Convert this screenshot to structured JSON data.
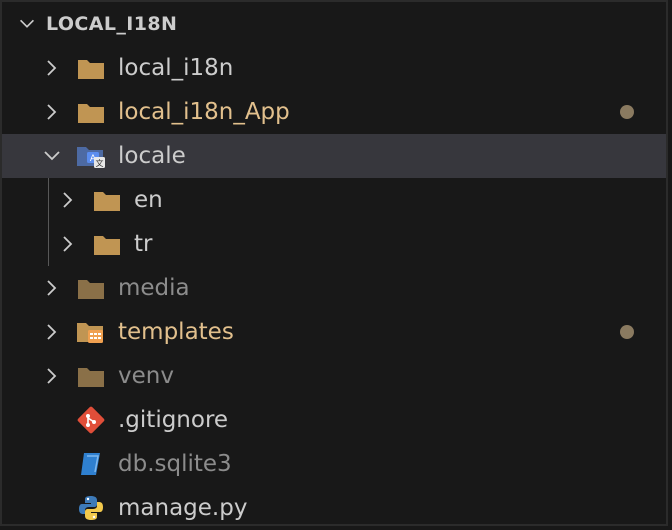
{
  "explorer": {
    "root_title": "LOCAL_I18N",
    "items": [
      {
        "label": "local_i18n"
      },
      {
        "label": "local_i18n_App"
      },
      {
        "label": "locale"
      },
      {
        "label": "en"
      },
      {
        "label": "tr"
      },
      {
        "label": "media"
      },
      {
        "label": "templates"
      },
      {
        "label": "venv"
      },
      {
        "label": ".gitignore"
      },
      {
        "label": "db.sqlite3"
      },
      {
        "label": "manage.py"
      }
    ]
  },
  "colors": {
    "background": "#181818",
    "selected_row": "#37373d",
    "text_default": "#cccccc",
    "text_modified": "#e2c08d",
    "text_ignored": "#8c8c8c",
    "folder": "#c09553",
    "modified_dot": "#8a7a60"
  },
  "icons": {
    "folder": "folder-icon",
    "locale": "translate-folder-icon",
    "templates": "templates-folder-icon",
    "gitignore": "git-icon",
    "sqlite": "database-icon",
    "python": "python-icon"
  }
}
